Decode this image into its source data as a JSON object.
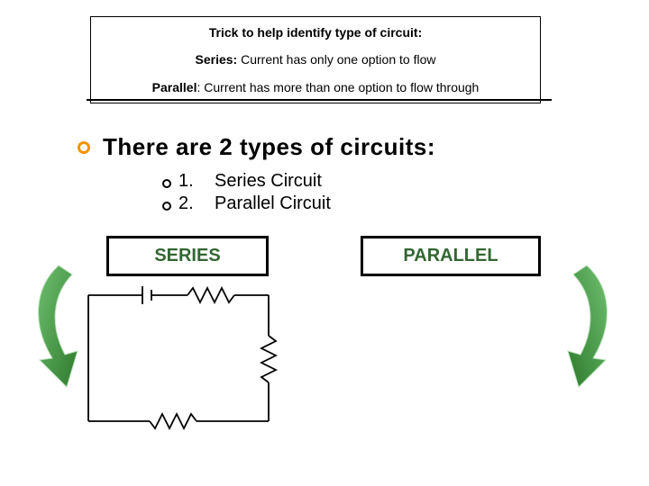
{
  "trick": {
    "title": "Trick to help identify type of circuit:",
    "series_label": "Series:",
    "series_text": " Current has only one option to flow",
    "parallel_label": "Parallel",
    "parallel_text": ": Current has more than one option to flow through"
  },
  "heading": "There are 2 types of circuits:",
  "list": {
    "items": [
      {
        "num": "1.",
        "text": "Series Circuit"
      },
      {
        "num": "2.",
        "text": "Parallel Circuit"
      }
    ]
  },
  "labels": {
    "series": "SERIES",
    "parallel": "PARALLEL"
  },
  "colors": {
    "accent_orange": "#f29300",
    "label_green": "#336633",
    "arrow_green": "#3d8f3d"
  }
}
